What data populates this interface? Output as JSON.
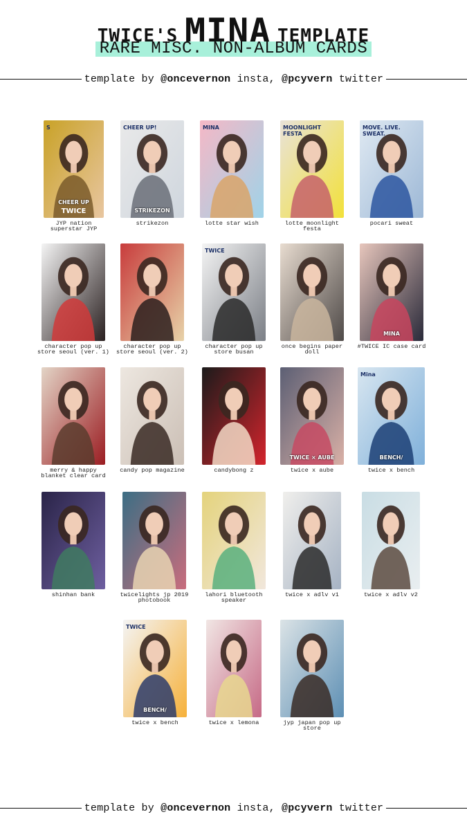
{
  "header": {
    "title_prefix": "TWICE'S",
    "title_member": "MINA",
    "title_suffix": "TEMPLATE",
    "subtitle": "RARE MISC. NON-ALBUM CARDS"
  },
  "credit": {
    "lead": "template by ",
    "handle1": "@oncevernon",
    "mid": " insta, ",
    "handle2": "@pcyvern",
    "tail": " twitter"
  },
  "cards": [
    {
      "caption": "JYP nation superstar JYP",
      "print_top": "S",
      "print_bottom": "CHEER UP",
      "print_logo": "TWICE",
      "colors": [
        "#c9a227",
        "#e8c6a0",
        "#7a5a2a"
      ]
    },
    {
      "caption": "strikezon",
      "print_top": "CHEER UP!",
      "print_bottom": "STRIKEZON",
      "colors": [
        "#e9e9e9",
        "#cfd6de",
        "#6a6f78"
      ]
    },
    {
      "caption": "lotte star wish",
      "print_top": "MINA",
      "colors": [
        "#f5b8c6",
        "#9fd3e8",
        "#d9a56a"
      ]
    },
    {
      "caption": "lotte moonlight festa",
      "print_top": "MOONLIGHT FESTA",
      "colors": [
        "#e9e2d8",
        "#f2e13a",
        "#c5626b"
      ]
    },
    {
      "caption": "pocari sweat",
      "print_top": "MOVE. LIVE. SWEAT.",
      "colors": [
        "#dfe9f2",
        "#9db8d6",
        "#2d56a0"
      ]
    },
    {
      "caption": "character pop up store seoul (ver. 1)",
      "colors": [
        "#f4f4f4",
        "#2a2020",
        "#d03a3a"
      ]
    },
    {
      "caption": "character pop up store seoul (ver. 2)",
      "colors": [
        "#c83c3c",
        "#e7d2a8",
        "#2b1f1d"
      ]
    },
    {
      "caption": "character pop up store busan",
      "print_top": "TWICE",
      "colors": [
        "#f4f4f4",
        "#7b7f86",
        "#2a2a2a"
      ]
    },
    {
      "caption": "once begins paper doll",
      "colors": [
        "#e8dcd0",
        "#4f4a48",
        "#c9b59e"
      ]
    },
    {
      "caption": "#TWICE IC case card",
      "print_bottom": "MINA",
      "colors": [
        "#e7c6bc",
        "#2a2a3a",
        "#c8455e"
      ]
    },
    {
      "caption": "merry & happy blanket clear card",
      "colors": [
        "#e3d4c6",
        "#9b1d22",
        "#5a3c2e"
      ]
    },
    {
      "caption": "candy pop magazine",
      "colors": [
        "#ede7e0",
        "#cbbfb5",
        "#3a2a24"
      ]
    },
    {
      "caption": "candybong z",
      "colors": [
        "#1b1b1b",
        "#d3242c",
        "#f2d9c6"
      ]
    },
    {
      "caption": "twice x aube",
      "print_bottom": "TWICE × AUBE",
      "colors": [
        "#5c5f74",
        "#d9b0a6",
        "#c64a63"
      ]
    },
    {
      "caption": "twice x bench",
      "print_top": "Mina",
      "print_bottom": "BENCH/",
      "colors": [
        "#d8e6f0",
        "#7fb0da",
        "#1c3f75"
      ]
    },
    {
      "caption": "shinhan bank",
      "colors": [
        "#2a2448",
        "#6e5fa0",
        "#3f7a60"
      ]
    },
    {
      "caption": "twicelights jp 2019 photobook",
      "colors": [
        "#3c6e84",
        "#c96d7d",
        "#e7d3b2"
      ]
    },
    {
      "caption": "lahori bluetooth speaker",
      "colors": [
        "#e4d37c",
        "#f1e7dc",
        "#59b07e"
      ]
    },
    {
      "caption": "twice x adlv v1",
      "colors": [
        "#f0efec",
        "#a6b3c4",
        "#2b2b2b"
      ]
    },
    {
      "caption": "twice x adlv v2",
      "colors": [
        "#c9dde4",
        "#e9eef0",
        "#5d4b41"
      ]
    },
    {
      "caption": "twice x bench",
      "print_top": "TWICE",
      "print_bottom": "BENCH/",
      "colors": [
        "#f4f4f4",
        "#f6b13a",
        "#2d3c6b"
      ]
    },
    {
      "caption": "twice x lemona",
      "colors": [
        "#f1e6e4",
        "#c66a86",
        "#e8d78f"
      ]
    },
    {
      "caption": "jyp japan pop up store",
      "colors": [
        "#dbe3e6",
        "#5d8fb4",
        "#3a2c26"
      ]
    }
  ]
}
